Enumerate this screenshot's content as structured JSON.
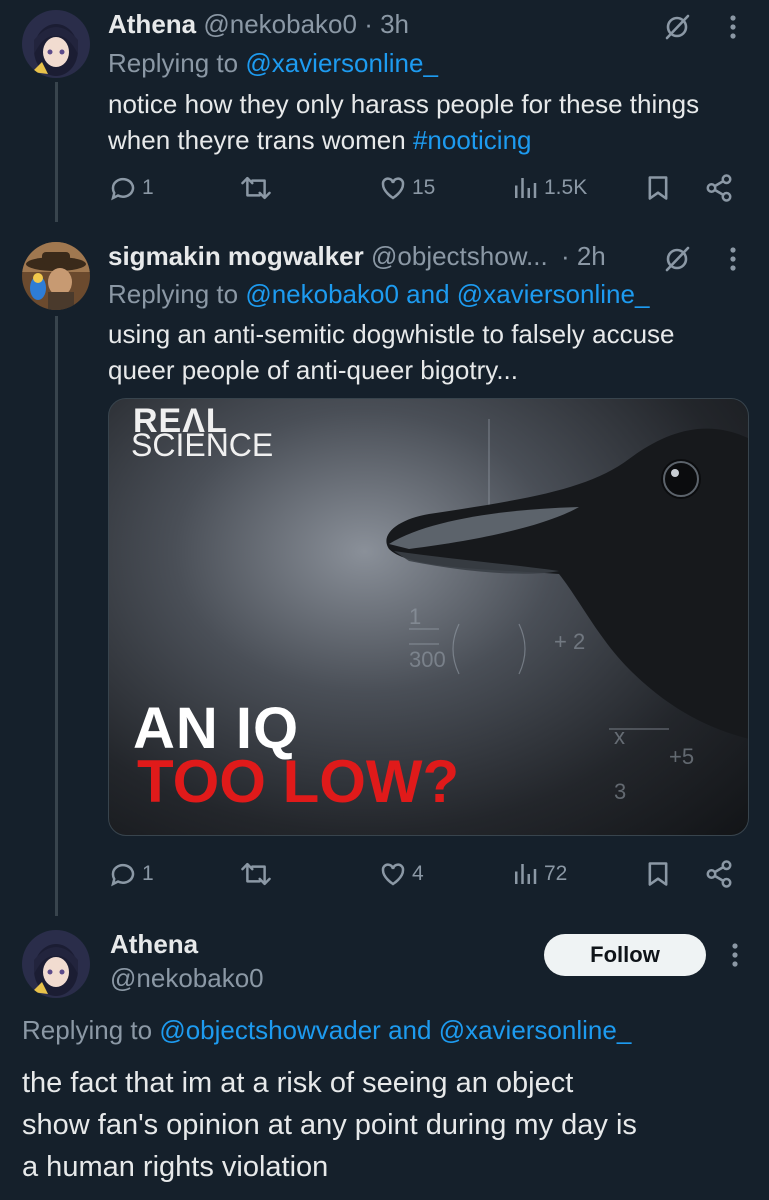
{
  "tweet1": {
    "name": "Athena",
    "handle": "@nekobako0",
    "time": "· 3h",
    "replying_prefix": "Replying to",
    "replying_to": "@xaviersonline_",
    "text": "notice how they only harass people for these things when theyre trans women",
    "hashtag": "#nooticing",
    "replies": "1",
    "likes": "15",
    "views": "1.5K"
  },
  "tweet2": {
    "name": "sigmakin mogwalker",
    "handle": "@objectshow...",
    "time": "· 2h",
    "replying_prefix": "Replying to",
    "replying_to_1": "@nekobako0",
    "replying_and": "and",
    "replying_to_2": "@xaviersonline_",
    "text_line1": "using an anti-semitic dogwhistle to falsely accuse",
    "text_line2": "queer people of anti-queer bigotry...",
    "media": {
      "brand_line1": "REΛL",
      "brand_line2": "SCIENCE",
      "headline_line1": "AN IQ",
      "headline_line2": "TOO LOW?"
    },
    "replies": "1",
    "likes": "4",
    "views": "72"
  },
  "tweet3": {
    "name": "Athena",
    "handle": "@nekobako0",
    "follow_label": "Follow",
    "replying_prefix": "Replying to",
    "replying_to_1": "@objectshowvader",
    "replying_and": "and",
    "replying_to_2": "@xaviersonline_",
    "text_line1": "the fact that im at a risk of seeing an object",
    "text_line2": "show fan's opinion at any point during my day is",
    "text_line3": "a human rights violation"
  },
  "colors": {
    "background": "#15202b",
    "link": "#1d9bf0",
    "muted": "#8b98a5",
    "headline_red": "#e01a1a"
  },
  "icons": [
    "grok-slash-icon",
    "more-icon",
    "reply-icon",
    "retweet-icon",
    "like-icon",
    "views-icon",
    "bookmark-icon",
    "share-icon"
  ]
}
